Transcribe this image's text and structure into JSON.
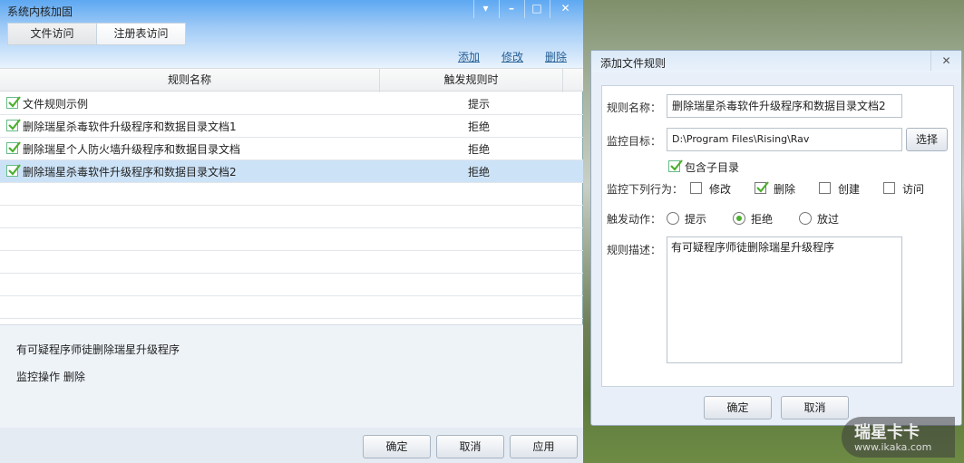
{
  "main": {
    "title": "系统内核加固",
    "tabs": [
      "文件访问",
      "注册表访问"
    ],
    "links": {
      "add": "添加",
      "edit": "修改",
      "delete": "删除"
    },
    "columns": [
      "规则名称",
      "触发规则时"
    ],
    "rows": [
      {
        "name": "文件规则示例",
        "trigger": "提示",
        "checked": true
      },
      {
        "name": "删除瑞星杀毒软件升级程序和数据目录文档1",
        "trigger": "拒绝",
        "checked": true
      },
      {
        "name": "删除瑞星个人防火墙升级程序和数据目录文档",
        "trigger": "拒绝",
        "checked": true
      },
      {
        "name": "删除瑞星杀毒软件升级程序和数据目录文档2",
        "trigger": "拒绝",
        "checked": true,
        "selected": true
      }
    ],
    "detail": {
      "description": "有可疑程序师徒删除瑞星升级程序",
      "operation": "监控操作 删除"
    },
    "buttons": {
      "ok": "确定",
      "cancel": "取消",
      "apply": "应用"
    }
  },
  "dialog": {
    "title": "添加文件规则",
    "name_label": "规则名称：",
    "name_value": "删除瑞星杀毒软件升级程序和数据目录文档2",
    "target_label": "监控目标：",
    "target_value": "D:\\Program Files\\Rising\\Rav",
    "select": "选择",
    "include_sub": "包含子目录",
    "behavior_label": "监控下列行为：",
    "behaviors": [
      {
        "label": "修改",
        "checked": false
      },
      {
        "label": "删除",
        "checked": true
      },
      {
        "label": "创建",
        "checked": false
      },
      {
        "label": "访问",
        "checked": false
      }
    ],
    "action_label": "触发动作：",
    "actions": [
      {
        "label": "提示",
        "selected": false
      },
      {
        "label": "拒绝",
        "selected": true
      },
      {
        "label": "放过",
        "selected": false
      }
    ],
    "desc_label": "规则描述：",
    "desc_value": "有可疑程序师徒删除瑞星升级程序",
    "ok": "确定",
    "cancel": "取消"
  },
  "watermark": {
    "brand": "瑞星卡卡",
    "url": "www.ikaka.com"
  },
  "colors": {
    "accent": "#5da8f2",
    "selected_row": "#cce2f7",
    "check": "#4caf2e"
  }
}
